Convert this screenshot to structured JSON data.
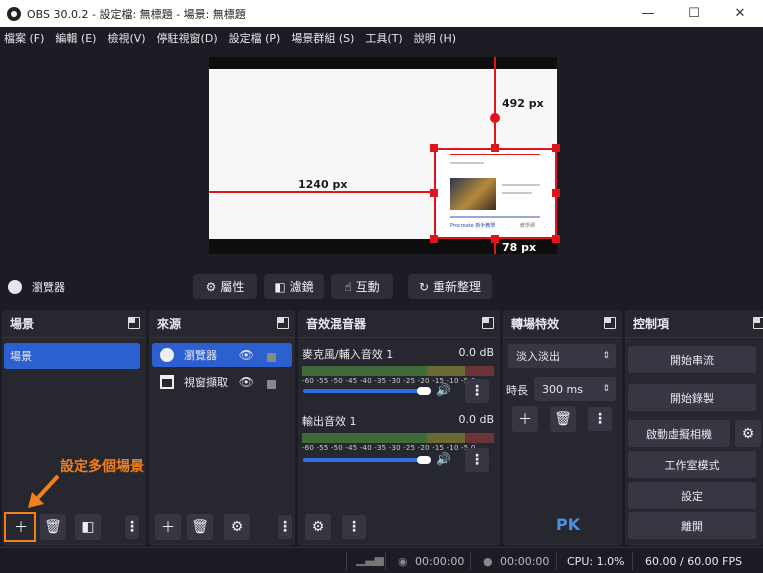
{
  "titlebar": {
    "title": "OBS 30.0.2 - 設定檔: 無標題 - 場景: 無標題",
    "minimize": "—",
    "maximize": "☐",
    "close": "✕"
  },
  "menu": [
    "檔案 (F)",
    "編輯 (E)",
    "檢視(V)",
    "停駐視窗(D)",
    "設定檔 (P)",
    "場景群組 (S)",
    "工具(T)",
    "說明 (H)"
  ],
  "preview": {
    "measure_top": "492 px",
    "measure_left": "1240 px",
    "measure_bottom": "78 px",
    "browser_headline": "Procreate 新手教學",
    "browser_small": "教學網"
  },
  "source_toolbar": {
    "current_source": "瀏覽器",
    "properties": "屬性",
    "filters": "濾鏡",
    "interact": "互動",
    "refresh": "重新整理"
  },
  "scenes": {
    "title": "場景",
    "items": [
      "場景"
    ]
  },
  "sources": {
    "title": "來源",
    "items": [
      {
        "label": "瀏覽器",
        "icon": "globe-icon"
      },
      {
        "label": "視窗擷取",
        "icon": "window-icon"
      }
    ]
  },
  "mixer": {
    "title": "音效混音器",
    "channels": [
      {
        "name": "麥克風/輔入音效 1",
        "level": "0.0 dB"
      },
      {
        "name": "輸出音效 1",
        "level": "0.0 dB"
      }
    ],
    "ticks": "-60 -55 -50 -45 -40 -35 -30 -25 -20 -15 -10 -5 0"
  },
  "transitions": {
    "title": "轉場特效",
    "selected": "淡入淡出",
    "duration_label": "時長",
    "duration": "300 ms"
  },
  "controls": {
    "title": "控制項",
    "buttons": [
      "開始串流",
      "開始錄製",
      "啟動虛擬相機",
      "工作室模式",
      "設定",
      "離開"
    ]
  },
  "status": {
    "rec_time": "00:00:00",
    "stream_time": "00:00:00",
    "cpu": "CPU: 1.0%",
    "fps": "60.00 / 60.00 FPS"
  },
  "annotation": {
    "text": "設定多個場景"
  },
  "watermark": "PK",
  "colors": {
    "accent": "#2c5fd0",
    "annotation": "#f07f1c",
    "selection": "#e0141c"
  }
}
